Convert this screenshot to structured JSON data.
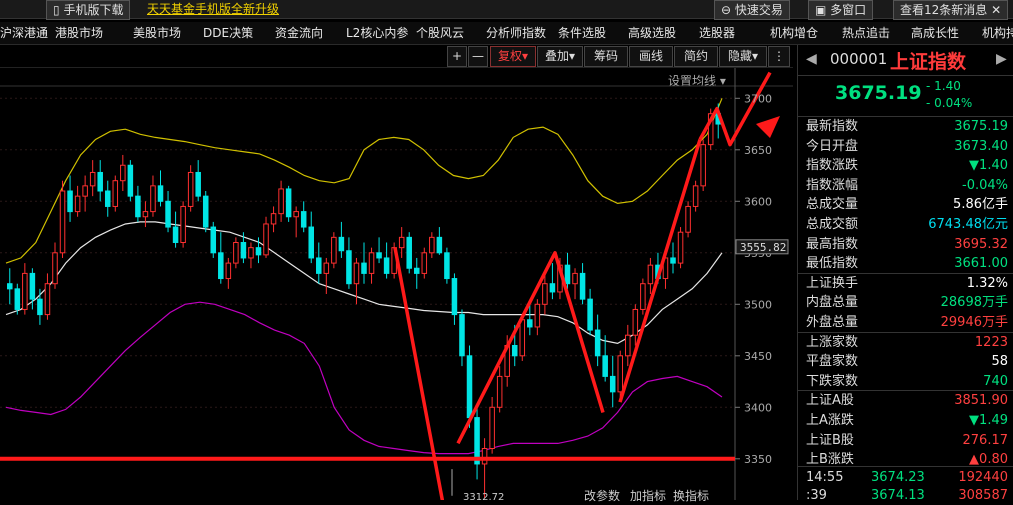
{
  "topbar": {
    "mobile_download": "手机版下载",
    "banner": "天天基金手机版全新升级",
    "quick_trade": "快速交易",
    "multi_window": "多窗口",
    "view_messages": "查看12条新消息"
  },
  "menu": [
    "沪深港通",
    "港股市场",
    "美股市场",
    "DDE决策",
    "资金流向",
    "L2核心内参",
    "个股风云",
    "分析师指数",
    "条件选股",
    "高级选股",
    "选股器",
    "机构增仓",
    "热点追击",
    "高成长性",
    "机构持"
  ],
  "toolbar": {
    "plus": "+",
    "minus": "—",
    "fuquan": "复权",
    "diejia": "叠加",
    "chouma": "筹码",
    "huaxian": "画线",
    "jianyue": "简约",
    "yincang": "隐藏",
    "setline": "设置均线"
  },
  "chart_footer": {
    "change_param": "改参数",
    "add_indicator": "加指标",
    "switch_indicator": "换指标"
  },
  "panel": {
    "code": "000001",
    "name": "上证指数",
    "price": "3675.19",
    "change": "- 1.40",
    "change_pct": "- 0.04%",
    "rows": [
      {
        "label": "最新指数",
        "value": "3675.19",
        "color": "#00e080"
      },
      {
        "label": "今日开盘",
        "value": "3673.40",
        "color": "#00e080"
      },
      {
        "label": "指数涨跌",
        "value": "▼1.40",
        "color": "#00e080"
      },
      {
        "label": "指数涨幅",
        "value": "-0.04%",
        "color": "#00e080"
      },
      {
        "label": "总成交量",
        "value": "5.86亿手",
        "color": "#ffffff"
      },
      {
        "label": "总成交额",
        "value": "6743.48亿元",
        "color": "#00ddee"
      },
      {
        "label": "最高指数",
        "value": "3695.32",
        "color": "#ff4040"
      },
      {
        "label": "最低指数",
        "value": "3661.00",
        "color": "#00e080"
      },
      {
        "label": "上证换手",
        "value": "1.32%",
        "color": "#ffffff"
      },
      {
        "label": "内盘总量",
        "value": "28698万手",
        "color": "#00e080"
      },
      {
        "label": "外盘总量",
        "value": "29946万手",
        "color": "#ff4040"
      },
      {
        "label": "上涨家数",
        "value": "1223",
        "color": "#ff4040"
      },
      {
        "label": "平盘家数",
        "value": "58",
        "color": "#ffffff"
      },
      {
        "label": "下跌家数",
        "value": "740",
        "color": "#00e080"
      },
      {
        "label": "上证A股",
        "value": "3851.90",
        "color": "#ff4040"
      },
      {
        "label": "上A涨跌",
        "value": "▼1.49",
        "color": "#00e080"
      },
      {
        "label": "上证B股",
        "value": "276.17",
        "color": "#ff4040"
      },
      {
        "label": "上B涨跌",
        "value": "▲0.80",
        "color": "#ff4040"
      }
    ],
    "ticks": [
      {
        "time": "14:55",
        "price": "3674.23",
        "vol": "192440"
      },
      {
        "time": ":39",
        "price": "3674.13",
        "vol": "308587"
      }
    ]
  },
  "chart_data": {
    "type": "candlestick",
    "yaxis_ticks": [
      3350,
      3400,
      3450,
      3500,
      3550,
      3600,
      3650,
      3700
    ],
    "ylim": [
      3310,
      3710
    ],
    "current_label": "3555.82",
    "low_label": "3312.72",
    "support_level": 3350,
    "colors": {
      "up": "#ff3030",
      "down": "#00e5e5",
      "boll_upper": "#d0c000",
      "boll_mid": "#e6e6e6",
      "boll_lower": "#c000c0",
      "annotation": "#ff1a1a"
    },
    "candles": [
      [
        3520,
        3535,
        3500,
        3515
      ],
      [
        3515,
        3520,
        3490,
        3495
      ],
      [
        3495,
        3540,
        3490,
        3530
      ],
      [
        3530,
        3535,
        3495,
        3505
      ],
      [
        3505,
        3515,
        3480,
        3490
      ],
      [
        3490,
        3530,
        3485,
        3520
      ],
      [
        3520,
        3560,
        3515,
        3550
      ],
      [
        3550,
        3620,
        3545,
        3610
      ],
      [
        3610,
        3625,
        3580,
        3590
      ],
      [
        3590,
        3615,
        3585,
        3605
      ],
      [
        3605,
        3625,
        3590,
        3615
      ],
      [
        3615,
        3640,
        3605,
        3628
      ],
      [
        3628,
        3640,
        3600,
        3610
      ],
      [
        3610,
        3620,
        3585,
        3595
      ],
      [
        3595,
        3625,
        3590,
        3620
      ],
      [
        3620,
        3645,
        3610,
        3635
      ],
      [
        3635,
        3640,
        3600,
        3605
      ],
      [
        3605,
        3615,
        3580,
        3585
      ],
      [
        3585,
        3600,
        3575,
        3590
      ],
      [
        3590,
        3625,
        3585,
        3615
      ],
      [
        3615,
        3630,
        3595,
        3600
      ],
      [
        3600,
        3610,
        3570,
        3575
      ],
      [
        3575,
        3590,
        3555,
        3560
      ],
      [
        3560,
        3600,
        3555,
        3595
      ],
      [
        3595,
        3635,
        3590,
        3628
      ],
      [
        3628,
        3640,
        3600,
        3605
      ],
      [
        3605,
        3610,
        3570,
        3575
      ],
      [
        3575,
        3580,
        3545,
        3550
      ],
      [
        3550,
        3570,
        3520,
        3525
      ],
      [
        3525,
        3545,
        3515,
        3540
      ],
      [
        3540,
        3565,
        3535,
        3560
      ],
      [
        3560,
        3570,
        3540,
        3545
      ],
      [
        3545,
        3560,
        3535,
        3555
      ],
      [
        3555,
        3565,
        3540,
        3548
      ],
      [
        3548,
        3585,
        3545,
        3578
      ],
      [
        3578,
        3595,
        3570,
        3588
      ],
      [
        3588,
        3620,
        3580,
        3612
      ],
      [
        3612,
        3615,
        3580,
        3585
      ],
      [
        3585,
        3595,
        3565,
        3590
      ],
      [
        3590,
        3600,
        3570,
        3575
      ],
      [
        3575,
        3590,
        3540,
        3545
      ],
      [
        3545,
        3560,
        3520,
        3530
      ],
      [
        3530,
        3545,
        3510,
        3540
      ],
      [
        3540,
        3570,
        3535,
        3565
      ],
      [
        3565,
        3580,
        3545,
        3552
      ],
      [
        3552,
        3565,
        3515,
        3520
      ],
      [
        3520,
        3545,
        3500,
        3540
      ],
      [
        3540,
        3560,
        3520,
        3530
      ],
      [
        3530,
        3555,
        3520,
        3550
      ],
      [
        3550,
        3565,
        3540,
        3545
      ],
      [
        3545,
        3560,
        3525,
        3530
      ],
      [
        3530,
        3560,
        3525,
        3555
      ],
      [
        3555,
        3575,
        3545,
        3565
      ],
      [
        3565,
        3570,
        3530,
        3535
      ],
      [
        3535,
        3545,
        3515,
        3530
      ],
      [
        3530,
        3555,
        3525,
        3550
      ],
      [
        3550,
        3570,
        3545,
        3565
      ],
      [
        3565,
        3575,
        3548,
        3550
      ],
      [
        3550,
        3555,
        3520,
        3525
      ],
      [
        3525,
        3530,
        3480,
        3490
      ],
      [
        3490,
        3495,
        3440,
        3450
      ],
      [
        3450,
        3460,
        3380,
        3390
      ],
      [
        3390,
        3400,
        3330,
        3345
      ],
      [
        3345,
        3370,
        3312,
        3360
      ],
      [
        3360,
        3410,
        3355,
        3400
      ],
      [
        3400,
        3440,
        3395,
        3430
      ],
      [
        3430,
        3470,
        3420,
        3460
      ],
      [
        3460,
        3480,
        3440,
        3450
      ],
      [
        3450,
        3490,
        3445,
        3485
      ],
      [
        3485,
        3500,
        3470,
        3478
      ],
      [
        3478,
        3505,
        3470,
        3500
      ],
      [
        3500,
        3530,
        3490,
        3520
      ],
      [
        3520,
        3540,
        3505,
        3512
      ],
      [
        3512,
        3545,
        3505,
        3538
      ],
      [
        3538,
        3550,
        3515,
        3520
      ],
      [
        3520,
        3535,
        3505,
        3530
      ],
      [
        3530,
        3540,
        3500,
        3505
      ],
      [
        3505,
        3515,
        3470,
        3475
      ],
      [
        3475,
        3490,
        3440,
        3450
      ],
      [
        3450,
        3470,
        3425,
        3430
      ],
      [
        3430,
        3450,
        3400,
        3415
      ],
      [
        3415,
        3455,
        3410,
        3450
      ],
      [
        3450,
        3480,
        3440,
        3470
      ],
      [
        3470,
        3500,
        3460,
        3495
      ],
      [
        3495,
        3525,
        3490,
        3520
      ],
      [
        3520,
        3545,
        3510,
        3538
      ],
      [
        3538,
        3550,
        3520,
        3525
      ],
      [
        3525,
        3550,
        3515,
        3545
      ],
      [
        3545,
        3560,
        3530,
        3540
      ],
      [
        3540,
        3575,
        3535,
        3570
      ],
      [
        3570,
        3600,
        3565,
        3595
      ],
      [
        3595,
        3620,
        3590,
        3615
      ],
      [
        3615,
        3660,
        3610,
        3655
      ],
      [
        3655,
        3690,
        3650,
        3685
      ],
      [
        3685,
        3695,
        3661,
        3675
      ]
    ],
    "boll_upper": [
      3540,
      3545,
      3560,
      3590,
      3620,
      3645,
      3660,
      3668,
      3670,
      3665,
      3662,
      3660,
      3658,
      3655,
      3652,
      3650,
      3648,
      3646,
      3640,
      3633,
      3625,
      3620,
      3618,
      3622,
      3650,
      3660,
      3662,
      3660,
      3650,
      3635,
      3625,
      3622,
      3625,
      3640,
      3662,
      3670,
      3672,
      3665,
      3645,
      3620,
      3605,
      3598,
      3600,
      3610,
      3625,
      3640,
      3650,
      3665,
      3700
    ],
    "boll_mid": [
      3490,
      3495,
      3505,
      3520,
      3540,
      3555,
      3565,
      3572,
      3578,
      3580,
      3580,
      3578,
      3576,
      3574,
      3572,
      3570,
      3565,
      3560,
      3550,
      3540,
      3530,
      3520,
      3515,
      3510,
      3505,
      3500,
      3498,
      3496,
      3494,
      3493,
      3492,
      3492,
      3490,
      3490,
      3490,
      3490,
      3490,
      3488,
      3482,
      3472,
      3465,
      3462,
      3470,
      3480,
      3495,
      3505,
      3515,
      3530,
      3550
    ],
    "boll_lower": [
      3400,
      3397,
      3395,
      3393,
      3398,
      3410,
      3425,
      3440,
      3455,
      3468,
      3480,
      3492,
      3500,
      3502,
      3500,
      3495,
      3490,
      3482,
      3475,
      3470,
      3462,
      3440,
      3400,
      3378,
      3368,
      3362,
      3360,
      3358,
      3356,
      3355,
      3355,
      3355,
      3358,
      3362,
      3365,
      3365,
      3365,
      3365,
      3368,
      3372,
      3380,
      3395,
      3415,
      3425,
      3428,
      3430,
      3425,
      3420,
      3410
    ]
  }
}
